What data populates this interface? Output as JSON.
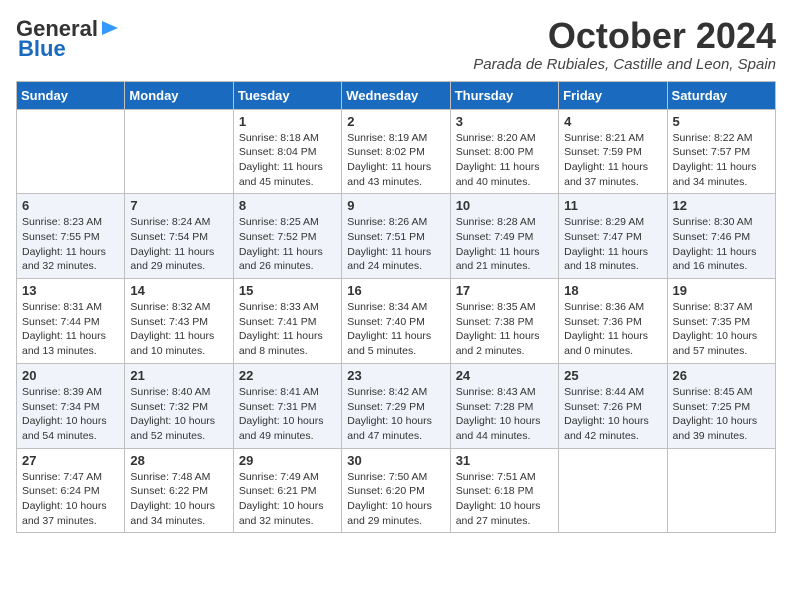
{
  "header": {
    "logo_line1": "General",
    "logo_line2": "Blue",
    "month": "October 2024",
    "location": "Parada de Rubiales, Castille and Leon, Spain"
  },
  "days_of_week": [
    "Sunday",
    "Monday",
    "Tuesday",
    "Wednesday",
    "Thursday",
    "Friday",
    "Saturday"
  ],
  "weeks": [
    [
      {
        "day": "",
        "sunrise": "",
        "sunset": "",
        "daylight": ""
      },
      {
        "day": "",
        "sunrise": "",
        "sunset": "",
        "daylight": ""
      },
      {
        "day": "1",
        "sunrise": "Sunrise: 8:18 AM",
        "sunset": "Sunset: 8:04 PM",
        "daylight": "Daylight: 11 hours and 45 minutes."
      },
      {
        "day": "2",
        "sunrise": "Sunrise: 8:19 AM",
        "sunset": "Sunset: 8:02 PM",
        "daylight": "Daylight: 11 hours and 43 minutes."
      },
      {
        "day": "3",
        "sunrise": "Sunrise: 8:20 AM",
        "sunset": "Sunset: 8:00 PM",
        "daylight": "Daylight: 11 hours and 40 minutes."
      },
      {
        "day": "4",
        "sunrise": "Sunrise: 8:21 AM",
        "sunset": "Sunset: 7:59 PM",
        "daylight": "Daylight: 11 hours and 37 minutes."
      },
      {
        "day": "5",
        "sunrise": "Sunrise: 8:22 AM",
        "sunset": "Sunset: 7:57 PM",
        "daylight": "Daylight: 11 hours and 34 minutes."
      }
    ],
    [
      {
        "day": "6",
        "sunrise": "Sunrise: 8:23 AM",
        "sunset": "Sunset: 7:55 PM",
        "daylight": "Daylight: 11 hours and 32 minutes."
      },
      {
        "day": "7",
        "sunrise": "Sunrise: 8:24 AM",
        "sunset": "Sunset: 7:54 PM",
        "daylight": "Daylight: 11 hours and 29 minutes."
      },
      {
        "day": "8",
        "sunrise": "Sunrise: 8:25 AM",
        "sunset": "Sunset: 7:52 PM",
        "daylight": "Daylight: 11 hours and 26 minutes."
      },
      {
        "day": "9",
        "sunrise": "Sunrise: 8:26 AM",
        "sunset": "Sunset: 7:51 PM",
        "daylight": "Daylight: 11 hours and 24 minutes."
      },
      {
        "day": "10",
        "sunrise": "Sunrise: 8:28 AM",
        "sunset": "Sunset: 7:49 PM",
        "daylight": "Daylight: 11 hours and 21 minutes."
      },
      {
        "day": "11",
        "sunrise": "Sunrise: 8:29 AM",
        "sunset": "Sunset: 7:47 PM",
        "daylight": "Daylight: 11 hours and 18 minutes."
      },
      {
        "day": "12",
        "sunrise": "Sunrise: 8:30 AM",
        "sunset": "Sunset: 7:46 PM",
        "daylight": "Daylight: 11 hours and 16 minutes."
      }
    ],
    [
      {
        "day": "13",
        "sunrise": "Sunrise: 8:31 AM",
        "sunset": "Sunset: 7:44 PM",
        "daylight": "Daylight: 11 hours and 13 minutes."
      },
      {
        "day": "14",
        "sunrise": "Sunrise: 8:32 AM",
        "sunset": "Sunset: 7:43 PM",
        "daylight": "Daylight: 11 hours and 10 minutes."
      },
      {
        "day": "15",
        "sunrise": "Sunrise: 8:33 AM",
        "sunset": "Sunset: 7:41 PM",
        "daylight": "Daylight: 11 hours and 8 minutes."
      },
      {
        "day": "16",
        "sunrise": "Sunrise: 8:34 AM",
        "sunset": "Sunset: 7:40 PM",
        "daylight": "Daylight: 11 hours and 5 minutes."
      },
      {
        "day": "17",
        "sunrise": "Sunrise: 8:35 AM",
        "sunset": "Sunset: 7:38 PM",
        "daylight": "Daylight: 11 hours and 2 minutes."
      },
      {
        "day": "18",
        "sunrise": "Sunrise: 8:36 AM",
        "sunset": "Sunset: 7:36 PM",
        "daylight": "Daylight: 11 hours and 0 minutes."
      },
      {
        "day": "19",
        "sunrise": "Sunrise: 8:37 AM",
        "sunset": "Sunset: 7:35 PM",
        "daylight": "Daylight: 10 hours and 57 minutes."
      }
    ],
    [
      {
        "day": "20",
        "sunrise": "Sunrise: 8:39 AM",
        "sunset": "Sunset: 7:34 PM",
        "daylight": "Daylight: 10 hours and 54 minutes."
      },
      {
        "day": "21",
        "sunrise": "Sunrise: 8:40 AM",
        "sunset": "Sunset: 7:32 PM",
        "daylight": "Daylight: 10 hours and 52 minutes."
      },
      {
        "day": "22",
        "sunrise": "Sunrise: 8:41 AM",
        "sunset": "Sunset: 7:31 PM",
        "daylight": "Daylight: 10 hours and 49 minutes."
      },
      {
        "day": "23",
        "sunrise": "Sunrise: 8:42 AM",
        "sunset": "Sunset: 7:29 PM",
        "daylight": "Daylight: 10 hours and 47 minutes."
      },
      {
        "day": "24",
        "sunrise": "Sunrise: 8:43 AM",
        "sunset": "Sunset: 7:28 PM",
        "daylight": "Daylight: 10 hours and 44 minutes."
      },
      {
        "day": "25",
        "sunrise": "Sunrise: 8:44 AM",
        "sunset": "Sunset: 7:26 PM",
        "daylight": "Daylight: 10 hours and 42 minutes."
      },
      {
        "day": "26",
        "sunrise": "Sunrise: 8:45 AM",
        "sunset": "Sunset: 7:25 PM",
        "daylight": "Daylight: 10 hours and 39 minutes."
      }
    ],
    [
      {
        "day": "27",
        "sunrise": "Sunrise: 7:47 AM",
        "sunset": "Sunset: 6:24 PM",
        "daylight": "Daylight: 10 hours and 37 minutes."
      },
      {
        "day": "28",
        "sunrise": "Sunrise: 7:48 AM",
        "sunset": "Sunset: 6:22 PM",
        "daylight": "Daylight: 10 hours and 34 minutes."
      },
      {
        "day": "29",
        "sunrise": "Sunrise: 7:49 AM",
        "sunset": "Sunset: 6:21 PM",
        "daylight": "Daylight: 10 hours and 32 minutes."
      },
      {
        "day": "30",
        "sunrise": "Sunrise: 7:50 AM",
        "sunset": "Sunset: 6:20 PM",
        "daylight": "Daylight: 10 hours and 29 minutes."
      },
      {
        "day": "31",
        "sunrise": "Sunrise: 7:51 AM",
        "sunset": "Sunset: 6:18 PM",
        "daylight": "Daylight: 10 hours and 27 minutes."
      },
      {
        "day": "",
        "sunrise": "",
        "sunset": "",
        "daylight": ""
      },
      {
        "day": "",
        "sunrise": "",
        "sunset": "",
        "daylight": ""
      }
    ]
  ]
}
